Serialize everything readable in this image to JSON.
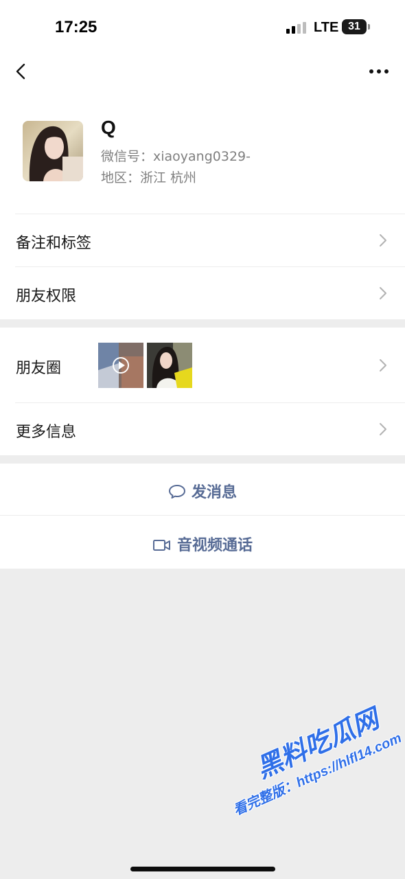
{
  "status_bar": {
    "time": "17:25",
    "network": "LTE",
    "battery": "31"
  },
  "nav": {
    "back_icon": "chevron-left-icon",
    "more_icon": "more-horizontal-icon"
  },
  "profile": {
    "name": "Q",
    "wechat_id": "微信号：xiaoyang0329-",
    "region": "地区：浙江 杭州"
  },
  "rows": {
    "remarks_tags": "备注和标签",
    "friend_permissions": "朋友权限",
    "moments": "朋友圈",
    "more_info": "更多信息"
  },
  "actions": {
    "send_message": "发消息",
    "video_call": "音视频通话"
  },
  "watermark": {
    "brand": "黑料吃瓜网",
    "url": "看完整版：https://hlfl14.com"
  },
  "colors": {
    "link_blue": "#576b95",
    "page_background": "#ededed",
    "watermark_blue": "#2f6fe8"
  }
}
